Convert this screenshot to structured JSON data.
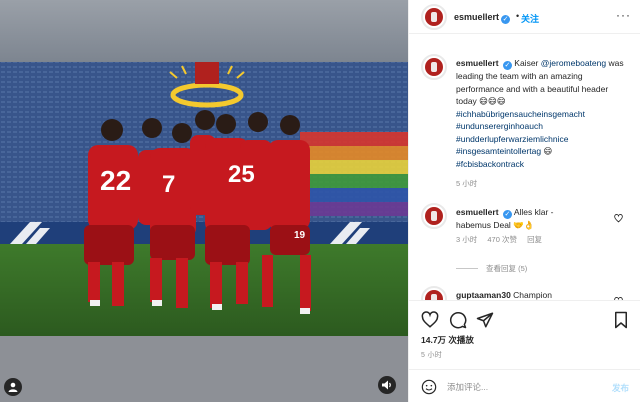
{
  "header": {
    "username": "esmuellert",
    "verified_mark": "✓",
    "separator": "•",
    "follow_label": "关注",
    "more_icon": "more-horizontal-icon",
    "more_label": "···"
  },
  "caption": {
    "username": "esmuellert",
    "text_lead": "Kaiser ",
    "mention": "@jeromeboateng",
    "text_body": " was leading the team with an amazing performance and with a beautiful header today 😄😄😄",
    "hashtags": [
      "#ichhabübrigensaucheinsgemacht",
      "#undunsererginhoauch",
      "#undderlupferwarziemlichnice",
      "#insgesamteintollertag",
      "#fcbisbackontrack"
    ],
    "hashtag_emoji": "😄",
    "time": "5 小时"
  },
  "comments": [
    {
      "username": "esmuellert",
      "text": "Alles klar - habemus Deal 🤝👌",
      "time": "3 小时",
      "likes": "470 次赞",
      "reply_label": "回复",
      "view_replies": "查看回复 (5)"
    },
    {
      "username": "guptaaman30",
      "text": "Champion"
    }
  ],
  "actions": {
    "likes_count": "14.7万 次播放",
    "post_time": "5 小时"
  },
  "comment_box": {
    "emoji_icon": "smile-icon",
    "placeholder": "添加评论...",
    "post_label": "发布"
  },
  "colors": {
    "accent": "#0095f6",
    "fcb_red": "#b0211e",
    "text": "#262626",
    "muted": "#8e8e8e"
  }
}
